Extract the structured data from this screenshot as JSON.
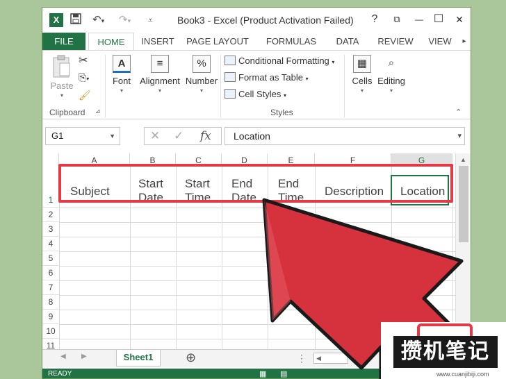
{
  "window": {
    "title": "Book3 - Excel (Product Activation Failed)",
    "app_icon": "X",
    "controls": {
      "help": "?",
      "restore": "⧉",
      "minimize": "—",
      "maximize": "☐",
      "close": "✕"
    }
  },
  "quick_access": {
    "save_icon": "save-icon",
    "undo_icon": "undo-icon",
    "redo_icon": "redo-icon",
    "customize_icon": "customize-icon"
  },
  "tabs": [
    "FILE",
    "HOME",
    "INSERT",
    "PAGE LAYOUT",
    "FORMULAS",
    "DATA",
    "REVIEW",
    "VIEW"
  ],
  "ribbon": {
    "clipboard": {
      "paste": "Paste",
      "label": "Clipboard"
    },
    "font": "Font",
    "alignment": "Alignment",
    "number": "Number",
    "styles": {
      "conditional": "Conditional Formatting",
      "format_table": "Format as Table",
      "cell_styles": "Cell Styles",
      "label": "Styles"
    },
    "cells": "Cells",
    "editing": "Editing"
  },
  "formula_bar": {
    "name_box": "G1",
    "fx": "fx",
    "content": "Location"
  },
  "columns": [
    "A",
    "B",
    "C",
    "D",
    "E",
    "F",
    "G"
  ],
  "rows": [
    "1",
    "2",
    "3",
    "4",
    "5",
    "6",
    "7",
    "8",
    "9",
    "10",
    "11"
  ],
  "row1": {
    "a": "Subject",
    "b1": "Start",
    "b2": "Date",
    "c1": "Start",
    "c2": "Time",
    "d1": "End",
    "d2": "Date",
    "e1": "End",
    "e2": "Time",
    "f": "Description",
    "g": "Location"
  },
  "sheets": {
    "active": "Sheet1",
    "add": "⊕"
  },
  "status": "READY",
  "watermark": {
    "logo": "攒机笔记",
    "url": "www.cuanjibiji.com"
  },
  "colors": {
    "excel_green": "#217346",
    "highlight_red": "#e23a46",
    "background": "#a9c79a"
  }
}
